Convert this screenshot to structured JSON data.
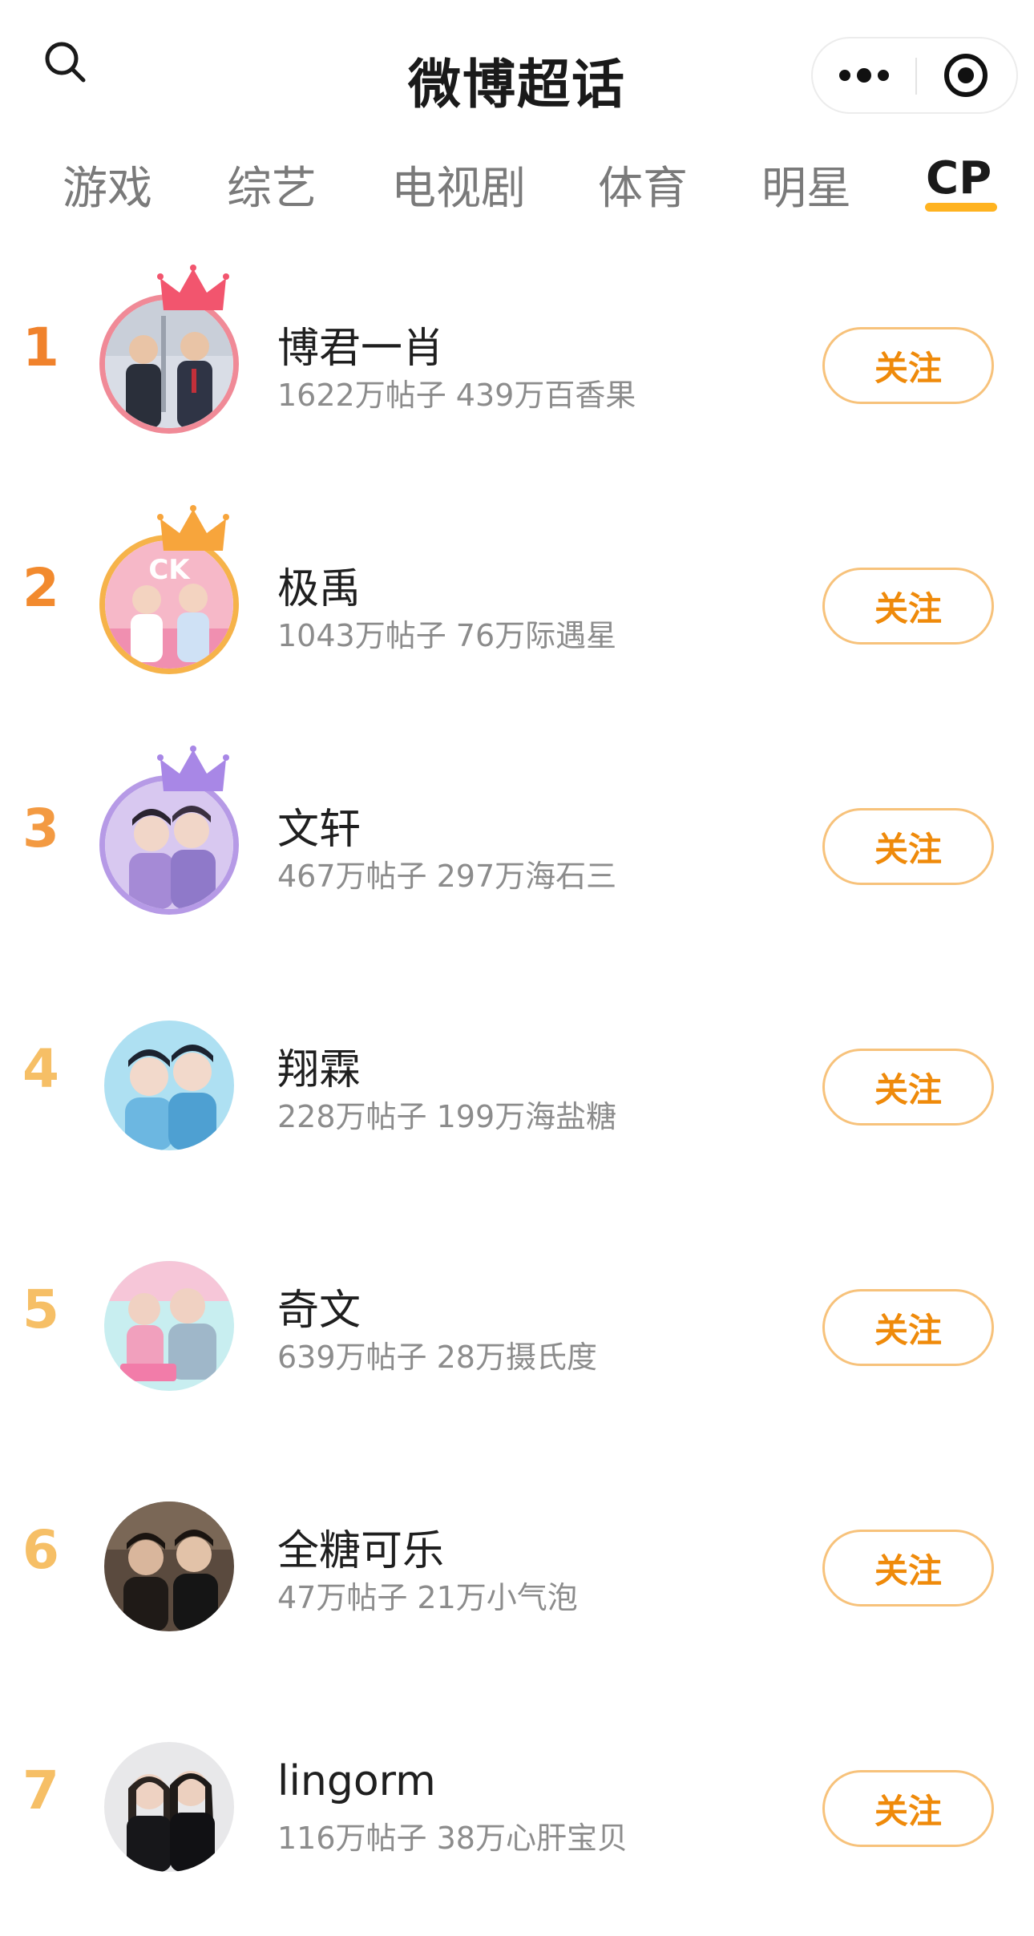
{
  "header": {
    "title": "微博超话",
    "search_icon": "search-icon",
    "more_icon": "more-dots-icon",
    "target_icon": "target-icon"
  },
  "tabs": [
    {
      "label": "游戏"
    },
    {
      "label": "综艺"
    },
    {
      "label": "电视剧"
    },
    {
      "label": "体育"
    },
    {
      "label": "明星"
    },
    {
      "label": "CP",
      "active": true
    }
  ],
  "colors": {
    "accent": "#ffb320",
    "follow_text": "#ef8a0a",
    "follow_border": "#f7c27b",
    "rank_1": "#f0822c",
    "rank_2": "#f28a2e",
    "rank_3": "#f39a42",
    "rank_rest": "#f6bf66"
  },
  "list": [
    {
      "rank": "1",
      "name": "博君一肖",
      "stats": "1622万帖子 439万百香果",
      "follow": "关注",
      "crown": "crown-icon-pink"
    },
    {
      "rank": "2",
      "name": "极禹",
      "stats": "1043万帖子 76万际遇星",
      "follow": "关注",
      "crown": "crown-icon-orange"
    },
    {
      "rank": "3",
      "name": "文轩",
      "stats": "467万帖子 297万海石三",
      "follow": "关注",
      "crown": "crown-icon-purple"
    },
    {
      "rank": "4",
      "name": "翔霖",
      "stats": "228万帖子 199万海盐糖",
      "follow": "关注"
    },
    {
      "rank": "5",
      "name": "奇文",
      "stats": "639万帖子 28万摄氏度",
      "follow": "关注"
    },
    {
      "rank": "6",
      "name": "全糖可乐",
      "stats": "47万帖子 21万小气泡",
      "follow": "关注"
    },
    {
      "rank": "7",
      "name": "lingorm",
      "stats": "116万帖子 38万心肝宝贝",
      "follow": "关注"
    }
  ]
}
